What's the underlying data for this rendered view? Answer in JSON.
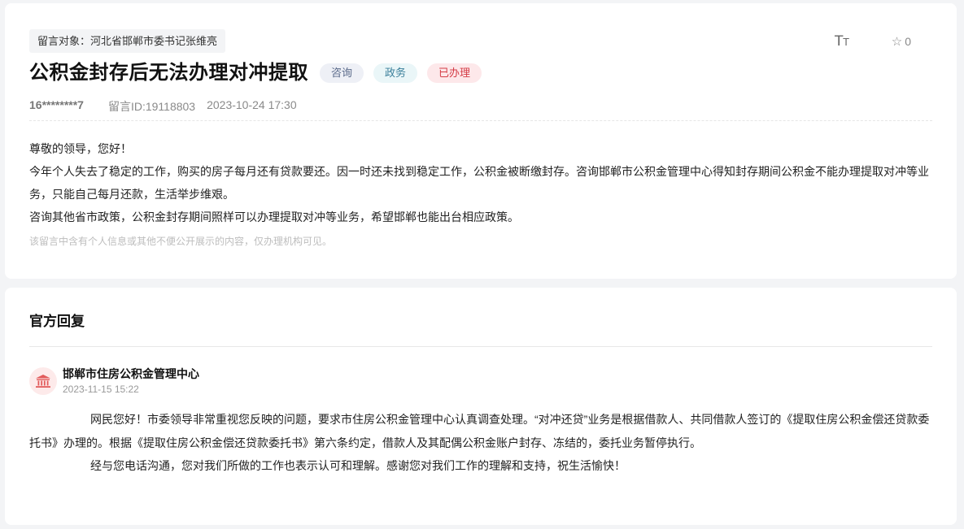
{
  "message": {
    "target_label": "留言对象：河北省邯郸市委书记张维亮",
    "title": "公积金封存后无法办理对冲提取",
    "tags": [
      "咨询",
      "政务",
      "已办理"
    ],
    "author": "16********7",
    "message_id": "留言ID:19118803",
    "date": "2023-10-24 17:30",
    "font_toggle_icon": "font-size-icon",
    "star_count": "0",
    "body": [
      "尊敬的领导，您好！",
      "今年个人失去了稳定的工作，购买的房子每月还有贷款要还。因一时还未找到稳定工作，公积金被断缴封存。咨询邯郸市公积金管理中心得知封存期间公积金不能办理提取对冲等业务，只能自己每月还款，生活举步维艰。",
      "咨询其他省市政策，公积金封存期间照样可以办理提取对冲等业务，希望邯郸也能出台相应政策。"
    ],
    "notice": "该留言中含有个人信息或其他不便公开展示的内容，仅办理机构可见。"
  },
  "reply": {
    "section_title": "官方回复",
    "org_name": "邯郸市住房公积金管理中心",
    "org_icon": "government-building-icon",
    "date": "2023-11-15 15:22",
    "paragraphs": [
      "网民您好！市委领导非常重视您反映的问题，要求市住房公积金管理中心认真调查处理。“对冲还贷”业务是根据借款人、共同借款人签订的《提取住房公积金偿还贷款委托书》办理的。根据《提取住房公积金偿还贷款委托书》第六条约定，借款人及其配偶公积金账户封存、冻结的，委托业务暂停执行。",
      "经与您电话沟通，您对我们所做的工作也表示认可和理解。感谢您对我们工作的理解和支持，祝生活愉快！"
    ]
  },
  "colors": {
    "accent_red": "#d43b45",
    "page_bg": "#f3f4f6"
  }
}
